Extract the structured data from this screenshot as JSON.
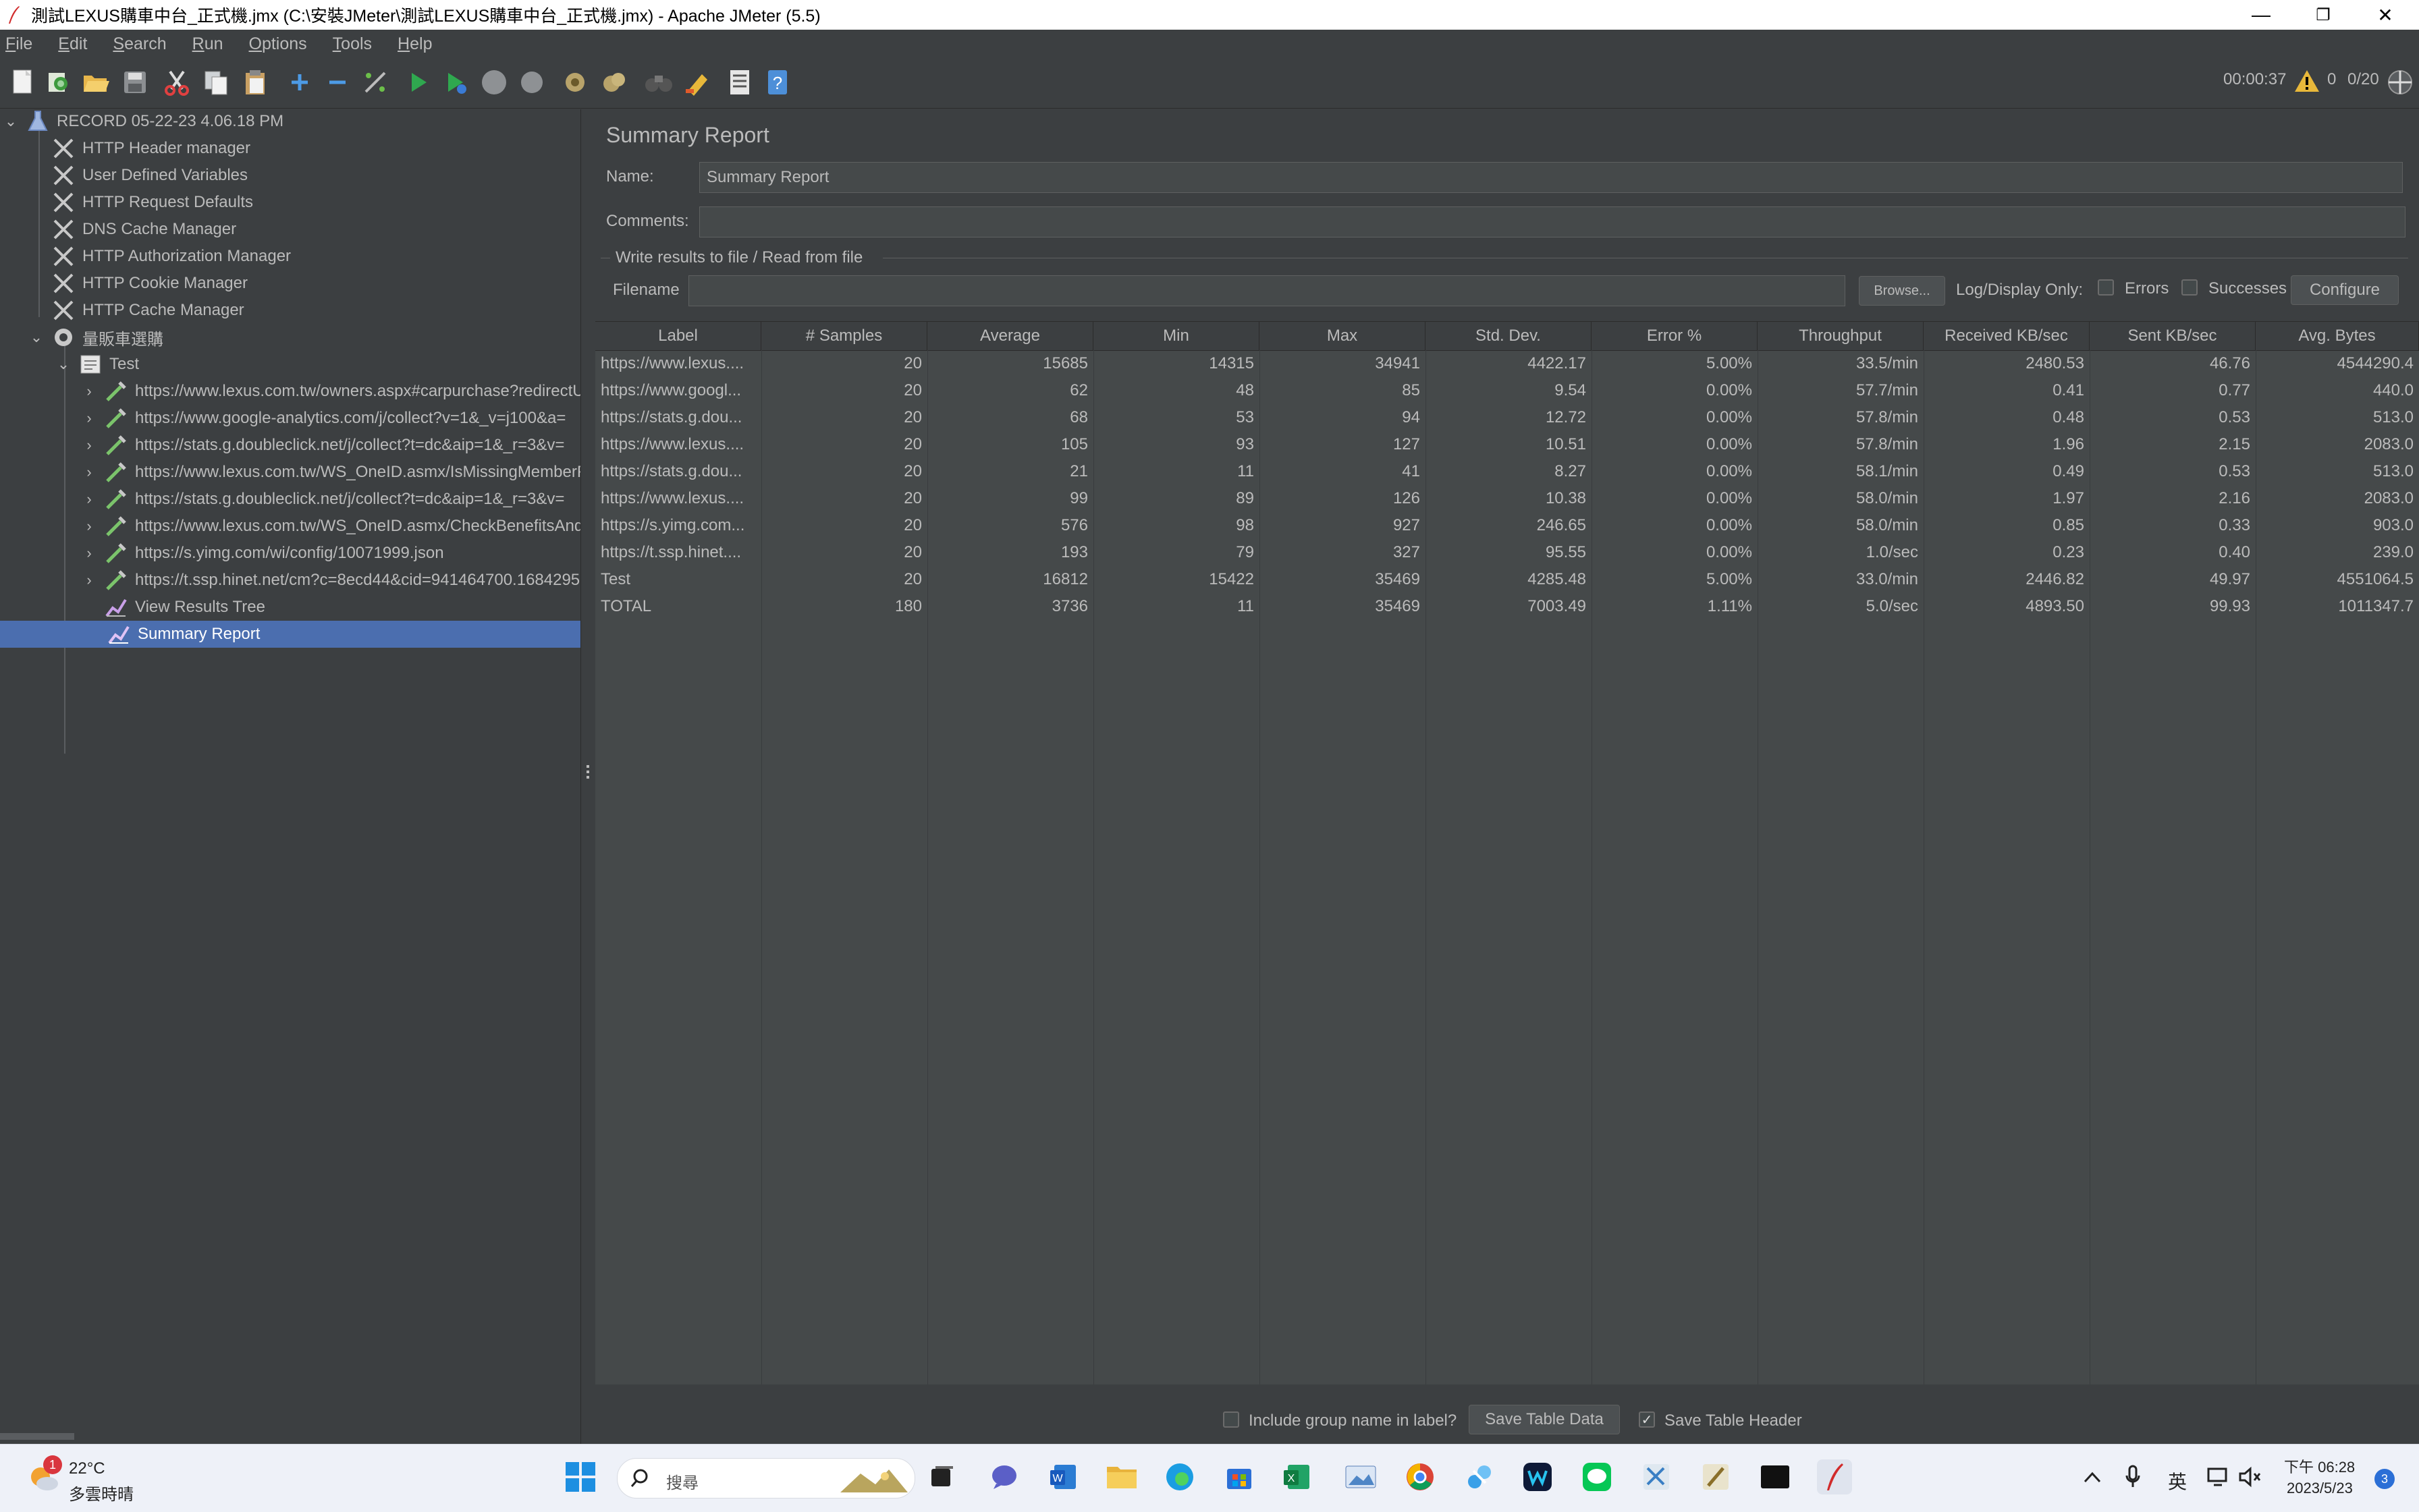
{
  "window": {
    "title": "測試LEXUS購車中台_正式機.jmx (C:\\安裝JMeter\\測試LEXUS購車中台_正式機.jmx) - Apache JMeter (5.5)",
    "minimize": "—",
    "restore": "❐",
    "close": "✕"
  },
  "menu": {
    "items": [
      {
        "first": "F",
        "rest": "ile"
      },
      {
        "first": "E",
        "rest": "dit"
      },
      {
        "first": "S",
        "rest": "earch"
      },
      {
        "first": "R",
        "rest": "un"
      },
      {
        "first": "O",
        "rest": "ptions"
      },
      {
        "first": "T",
        "rest": "ools"
      },
      {
        "first": "H",
        "rest": "elp"
      }
    ]
  },
  "toolbar": {
    "elapsed": "00:00:37",
    "warnings": "0",
    "threads": "0/20"
  },
  "tree": {
    "root": "RECORD 05-22-23 4.06.18 PM",
    "config_items": [
      "HTTP Header manager",
      "User Defined Variables",
      "HTTP Request Defaults",
      "DNS Cache Manager",
      "HTTP Authorization Manager",
      "HTTP Cookie Manager",
      "HTTP Cache Manager"
    ],
    "thread_group": "量販車選購",
    "transaction": "Test",
    "samplers": [
      "https://www.lexus.com.tw/owners.aspx#carpurchase?redirectU",
      "https://www.google-analytics.com/j/collect?v=1&_v=j100&a=",
      "https://stats.g.doubleclick.net/j/collect?t=dc&aip=1&_r=3&v=",
      "https://www.lexus.com.tw/WS_OneID.asmx/IsMissingMemberF",
      "https://stats.g.doubleclick.net/j/collect?t=dc&aip=1&_r=3&v=",
      "https://www.lexus.com.tw/WS_OneID.asmx/CheckBenefitsAnd",
      "https://s.yimg.com/wi/config/10071999.json",
      "https://t.ssp.hinet.net/cm?c=8ecd44&cid=941464700.1684295"
    ],
    "listeners": [
      "View Results Tree",
      "Summary Report"
    ]
  },
  "panel": {
    "title": "Summary Report",
    "name_label": "Name:",
    "name_value": "Summary Report",
    "comments_label": "Comments:",
    "comments_value": "",
    "write_results": "Write results to file / Read from file",
    "filename_label": "Filename",
    "filename_value": "",
    "browse": "Browse...",
    "log_display_only": "Log/Display Only:",
    "errors": "Errors",
    "successes": "Successes",
    "configure": "Configure",
    "include_group": "Include group name in label?",
    "save_table_data": "Save Table Data",
    "save_table_header": "Save Table Header"
  },
  "table": {
    "columns": [
      "Label",
      "# Samples",
      "Average",
      "Min",
      "Max",
      "Std. Dev.",
      "Error %",
      "Throughput",
      "Received KB/sec",
      "Sent KB/sec",
      "Avg. Bytes"
    ],
    "rows": [
      [
        "https://www.lexus....",
        "20",
        "15685",
        "14315",
        "34941",
        "4422.17",
        "5.00%",
        "33.5/min",
        "2480.53",
        "46.76",
        "4544290.4"
      ],
      [
        "https://www.googl...",
        "20",
        "62",
        "48",
        "85",
        "9.54",
        "0.00%",
        "57.7/min",
        "0.41",
        "0.77",
        "440.0"
      ],
      [
        "https://stats.g.dou...",
        "20",
        "68",
        "53",
        "94",
        "12.72",
        "0.00%",
        "57.8/min",
        "0.48",
        "0.53",
        "513.0"
      ],
      [
        "https://www.lexus....",
        "20",
        "105",
        "93",
        "127",
        "10.51",
        "0.00%",
        "57.8/min",
        "1.96",
        "2.15",
        "2083.0"
      ],
      [
        "https://stats.g.dou...",
        "20",
        "21",
        "11",
        "41",
        "8.27",
        "0.00%",
        "58.1/min",
        "0.49",
        "0.53",
        "513.0"
      ],
      [
        "https://www.lexus....",
        "20",
        "99",
        "89",
        "126",
        "10.38",
        "0.00%",
        "58.0/min",
        "1.97",
        "2.16",
        "2083.0"
      ],
      [
        "https://s.yimg.com...",
        "20",
        "576",
        "98",
        "927",
        "246.65",
        "0.00%",
        "58.0/min",
        "0.85",
        "0.33",
        "903.0"
      ],
      [
        "https://t.ssp.hinet....",
        "20",
        "193",
        "79",
        "327",
        "95.55",
        "0.00%",
        "1.0/sec",
        "0.23",
        "0.40",
        "239.0"
      ],
      [
        "Test",
        "20",
        "16812",
        "15422",
        "35469",
        "4285.48",
        "5.00%",
        "33.0/min",
        "2446.82",
        "49.97",
        "4551064.5"
      ],
      [
        "TOTAL",
        "180",
        "3736",
        "11",
        "35469",
        "7003.49",
        "1.11%",
        "5.0/sec",
        "4893.50",
        "99.93",
        "1011347.7"
      ]
    ]
  },
  "taskbar": {
    "weather_temp": "22°C",
    "weather_desc": "多雲時晴",
    "weather_badge": "1",
    "search": "搜尋",
    "ime": "英",
    "time": "下午 06:28",
    "date": "2023/5/23",
    "notifications": "3"
  }
}
